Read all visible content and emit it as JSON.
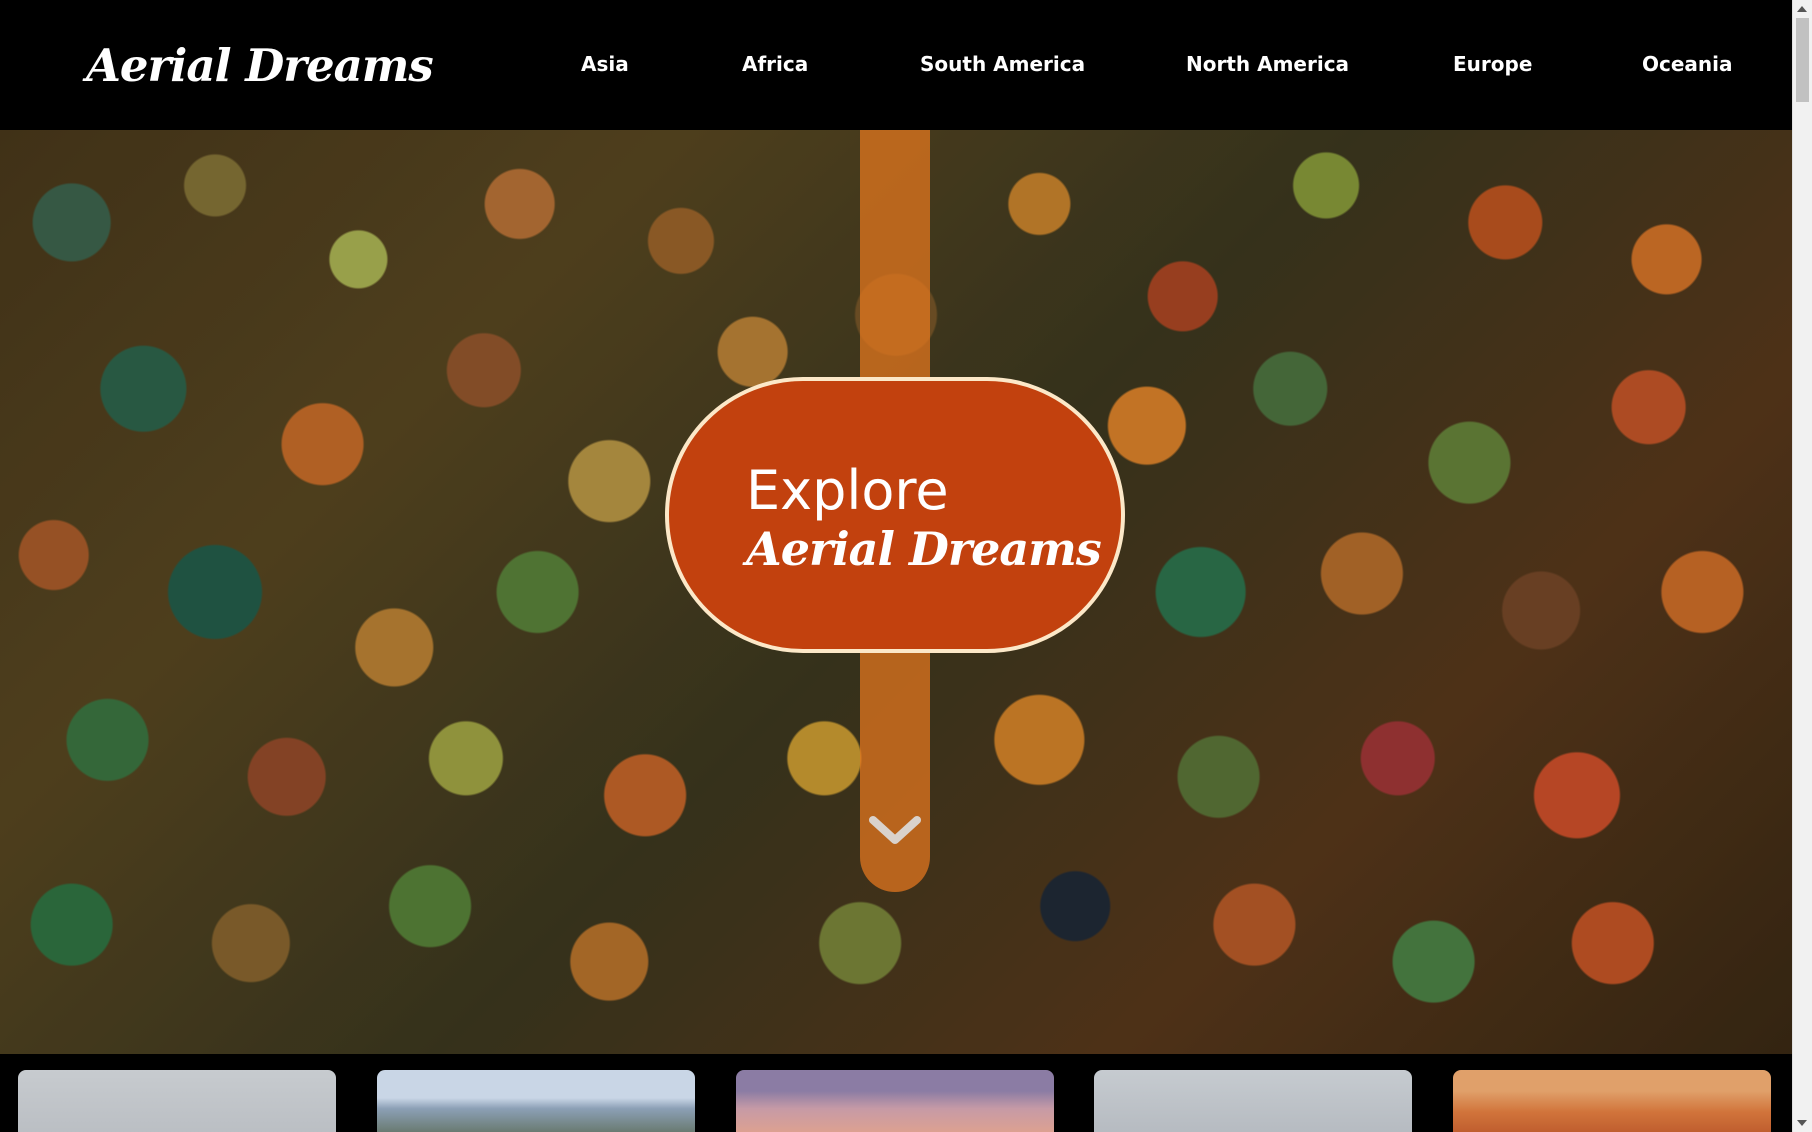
{
  "header": {
    "logo": "Aerial Dreams",
    "nav": [
      "Asia",
      "Africa",
      "South America",
      "North America",
      "Europe",
      "Oceania"
    ]
  },
  "hero": {
    "cta_line1": "Explore",
    "cta_line2": "Aerial Dreams",
    "scroll_icon": "chevron-down-icon"
  },
  "colors": {
    "header_bg": "#000000",
    "cta_bg": "#c2410e",
    "cta_border": "#fce8c8",
    "strip_bg": "#e8781e"
  }
}
